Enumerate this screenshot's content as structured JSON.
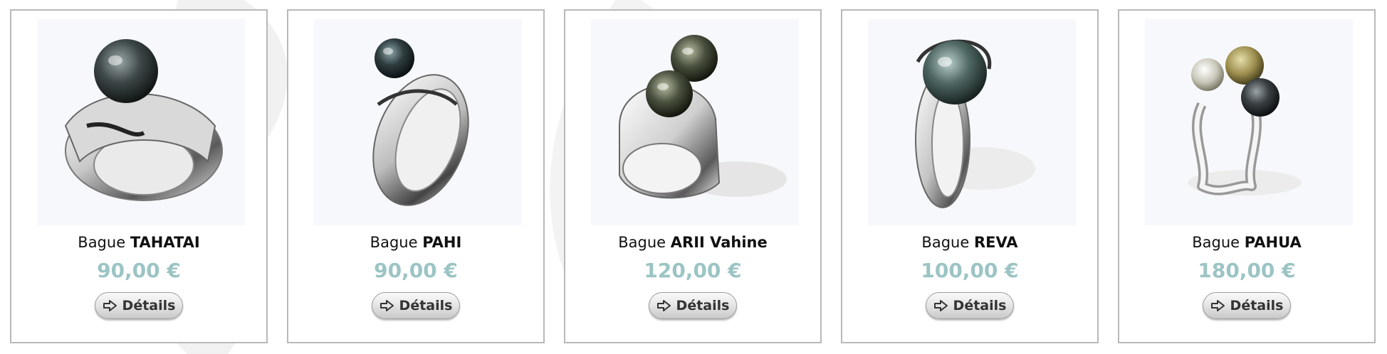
{
  "products": [
    {
      "prefix": "Bague",
      "name": "TAHATAI",
      "price": "90,00 €",
      "button_label": "Détails",
      "button_icon": "arrow-right-outline-icon"
    },
    {
      "prefix": "Bague",
      "name": "PAHI",
      "price": "90,00 €",
      "button_label": "Détails",
      "button_icon": "arrow-right-outline-icon"
    },
    {
      "prefix": "Bague",
      "name": "ARII Vahine",
      "price": "120,00 €",
      "button_label": "Détails",
      "button_icon": "arrow-right-outline-icon"
    },
    {
      "prefix": "Bague",
      "name": "REVA",
      "price": "100,00 €",
      "button_label": "Détails",
      "button_icon": "arrow-right-outline-icon"
    },
    {
      "prefix": "Bague",
      "name": "PAHUA",
      "price": "180,00 €",
      "button_label": "Détails",
      "button_icon": "arrow-right-outline-icon"
    }
  ],
  "colors": {
    "price": "#9cc4c4",
    "card_border": "#b9b9b9"
  }
}
